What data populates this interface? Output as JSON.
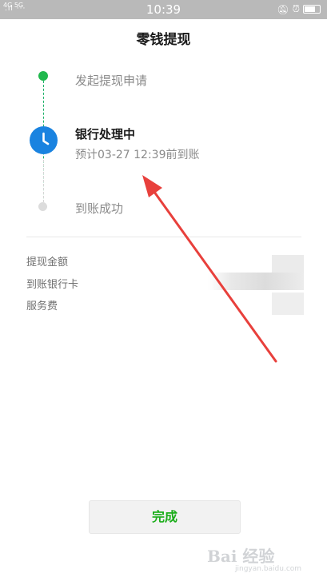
{
  "status_bar": {
    "carrier": "4G 5G",
    "signal": ".ıl ···",
    "time": "10:39",
    "icons": [
      "mute-icon",
      "alarm-icon",
      "battery-icon"
    ]
  },
  "header": {
    "title": "零钱提现"
  },
  "timeline": {
    "steps": [
      {
        "label": "发起提现申请",
        "state": "done"
      },
      {
        "label": "银行处理中",
        "sub": "预计03-27 12:39前到账",
        "state": "current"
      },
      {
        "label": "到账成功",
        "state": "pending"
      }
    ]
  },
  "details": {
    "rows": [
      {
        "label": "提现金额"
      },
      {
        "label": "到账银行卡"
      },
      {
        "label": "服务费"
      }
    ]
  },
  "footer": {
    "done_label": "完成"
  },
  "watermark": {
    "brand": "Bai 经验",
    "url": "jingyan.baidu.com"
  },
  "colors": {
    "accent_green": "#1aad19",
    "step_done": "#20b84d",
    "step_current": "#1a83e0",
    "annotation_arrow": "#e8403c"
  }
}
